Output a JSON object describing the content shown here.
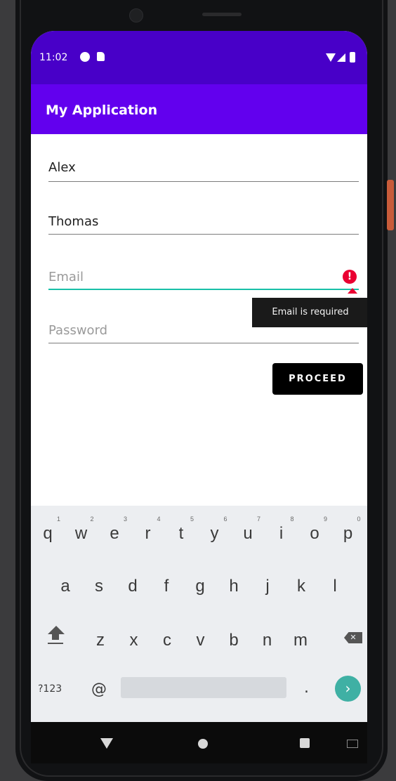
{
  "status": {
    "time": "11:02"
  },
  "appbar": {
    "title": "My Application"
  },
  "form": {
    "first_name": {
      "value": "Alex"
    },
    "last_name": {
      "value": "Thomas"
    },
    "email": {
      "placeholder": "Email",
      "error": "Email is required"
    },
    "password": {
      "placeholder": "Password"
    },
    "proceed_label": "PROCEED"
  },
  "keyboard": {
    "row1": [
      {
        "k": "q",
        "h": "1"
      },
      {
        "k": "w",
        "h": "2"
      },
      {
        "k": "e",
        "h": "3"
      },
      {
        "k": "r",
        "h": "4"
      },
      {
        "k": "t",
        "h": "5"
      },
      {
        "k": "y",
        "h": "6"
      },
      {
        "k": "u",
        "h": "7"
      },
      {
        "k": "i",
        "h": "8"
      },
      {
        "k": "o",
        "h": "9"
      },
      {
        "k": "p",
        "h": "0"
      }
    ],
    "row2": [
      "a",
      "s",
      "d",
      "f",
      "g",
      "h",
      "j",
      "k",
      "l"
    ],
    "row3": [
      "z",
      "x",
      "c",
      "v",
      "b",
      "n",
      "m"
    ],
    "mode_label": "?123",
    "at_label": "@",
    "dot_label": "."
  },
  "colors": {
    "status_bar": "#4800c8",
    "app_bar": "#6200ee",
    "focus_underline": "#18c0a8",
    "error": "#ea0032",
    "go_key": "#3fb0a4"
  },
  "icons": {
    "status": [
      "data-saver-icon",
      "sim-card-icon",
      "wifi-icon",
      "signal-icon",
      "battery-icon"
    ],
    "error": "error-icon",
    "keys": [
      "shift-icon",
      "backspace-icon",
      "go-arrow-icon"
    ],
    "nav": [
      "back-icon",
      "home-icon",
      "recents-icon",
      "keyboard-switch-icon"
    ]
  }
}
